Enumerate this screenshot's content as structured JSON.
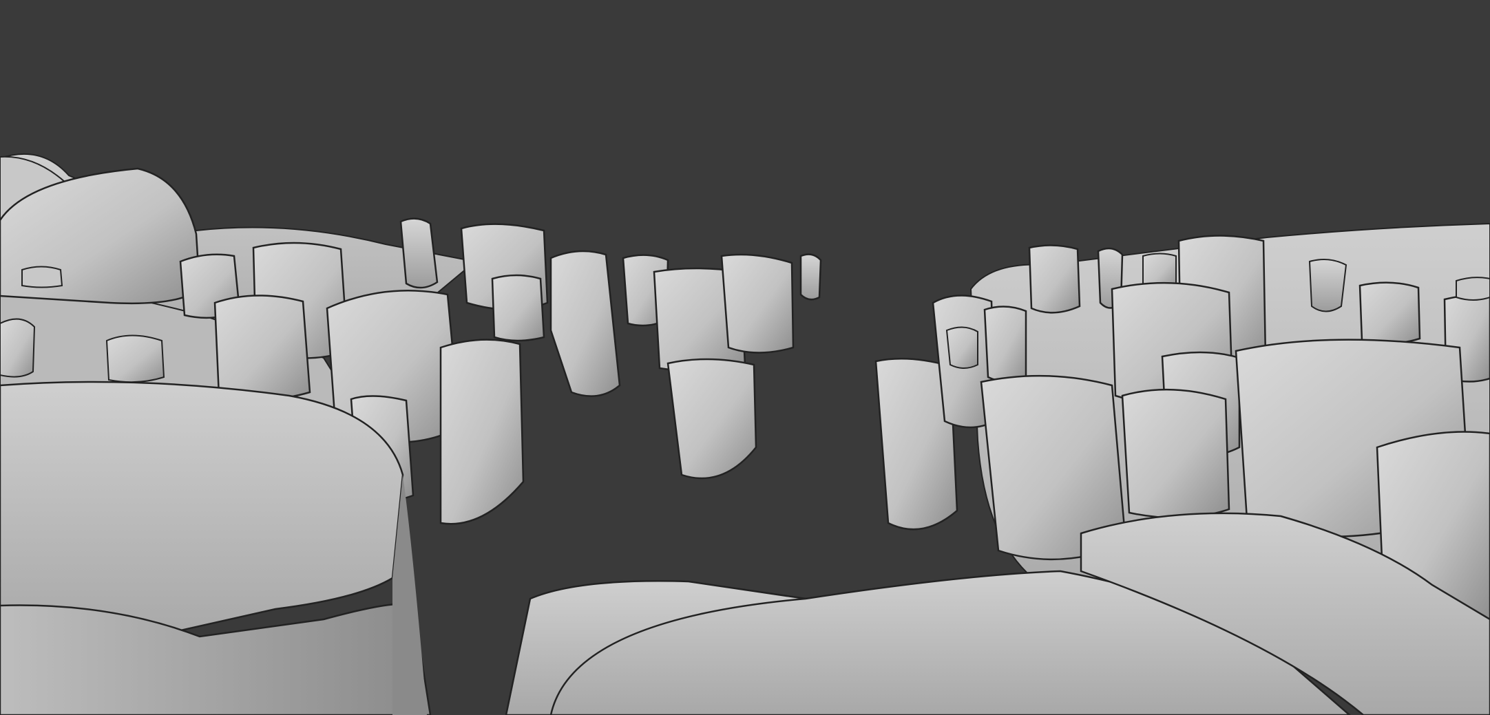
{
  "viewport": {
    "background_color": "#3a3a3a",
    "shading": "solid",
    "object_color": "#c4c4c4",
    "highlight_color": "#dadada",
    "shadow_color": "#8e8e8e",
    "outline_color": "#222222"
  },
  "scene": {
    "subject": "dental-model",
    "objects": [
      "lower-left-gum-block",
      "lower-right-gum-block",
      "upper-left-gum-ridge",
      "upper-right-gum-ridge",
      "left-molars",
      "right-molars",
      "incisors",
      "canines",
      "premolars"
    ]
  }
}
